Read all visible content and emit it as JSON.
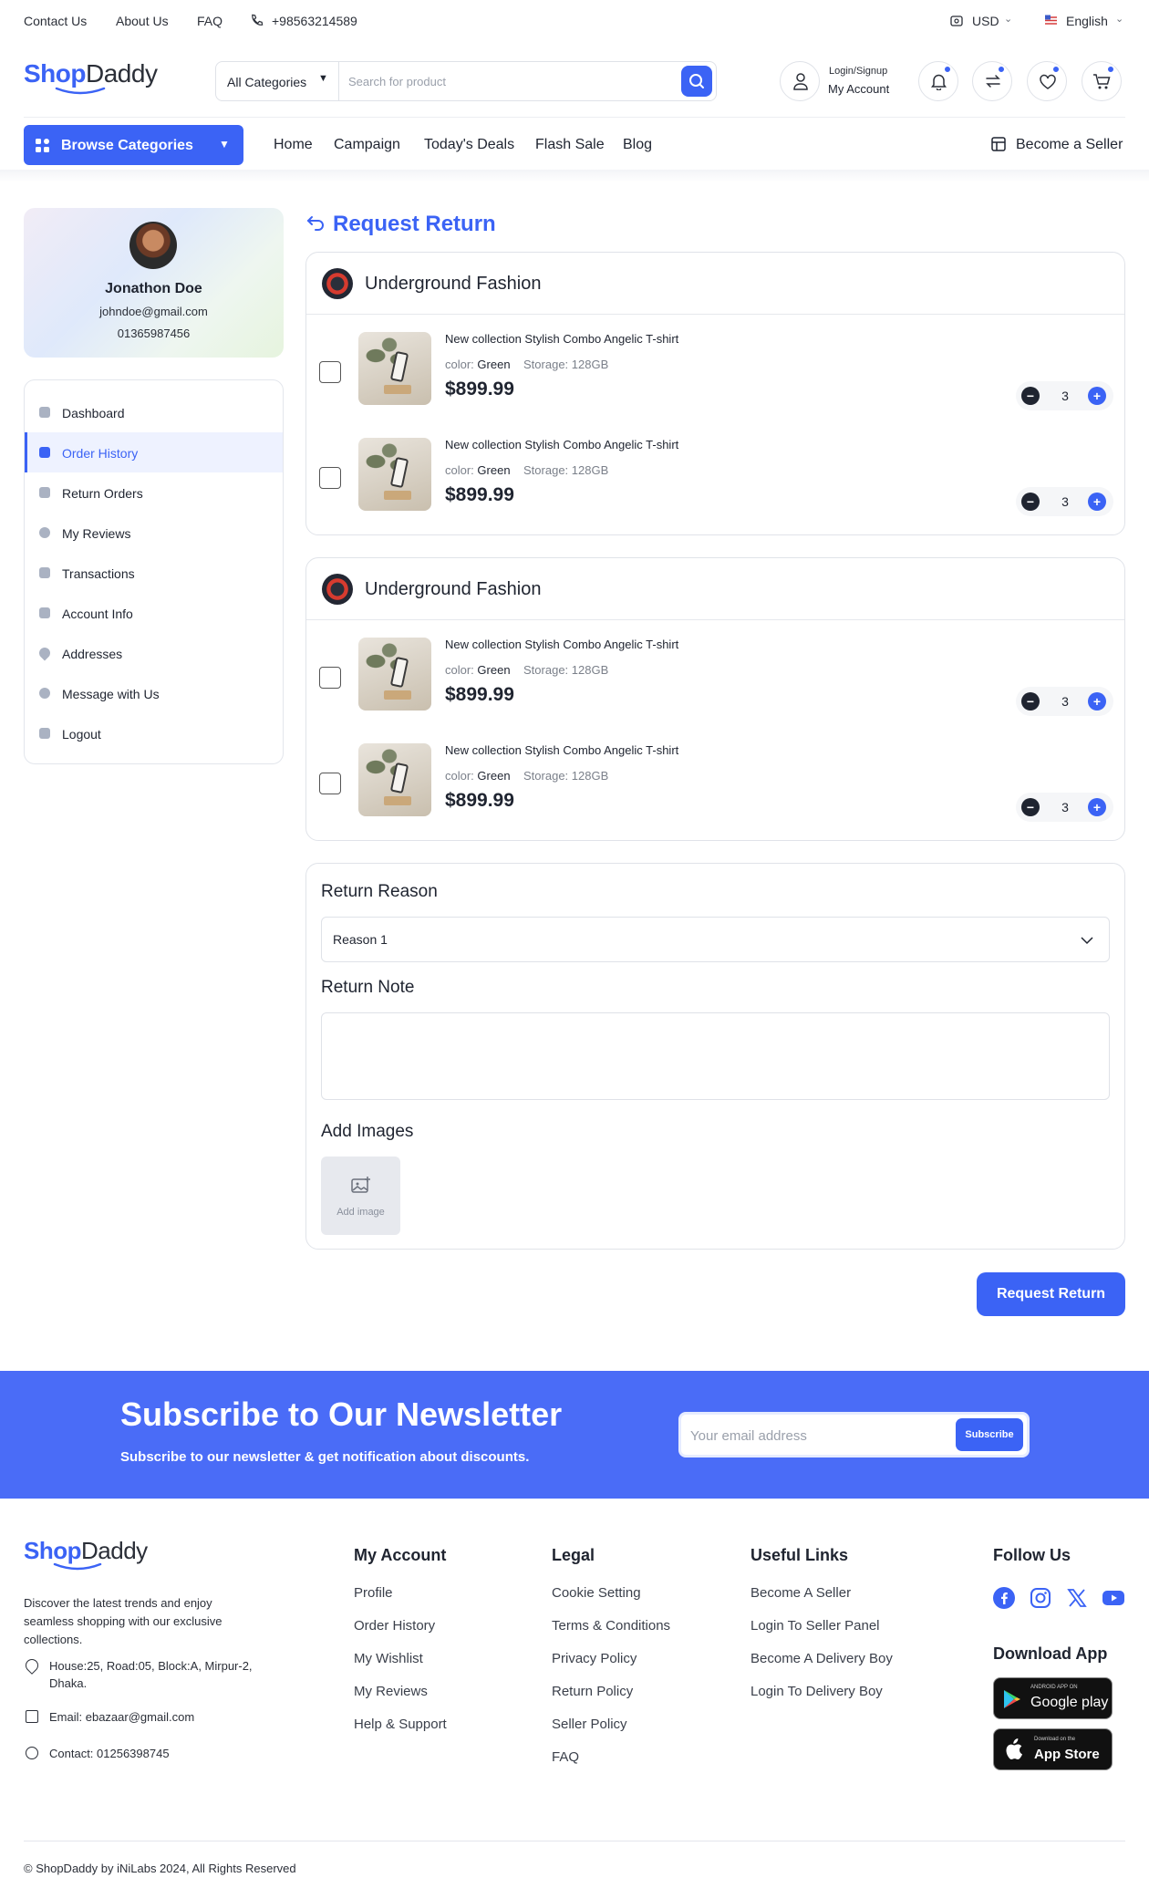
{
  "topbar": {
    "contact": "Contact Us",
    "about": "About Us",
    "faq": "FAQ",
    "phone": "+98563214589",
    "currency": "USD",
    "language": "English"
  },
  "header": {
    "logo_a": "Shop",
    "logo_b": "Daddy",
    "category_select": "All Categories",
    "search_placeholder": "Search for product",
    "login_label": "Login/Signup",
    "account_label": "My Account"
  },
  "nav": {
    "browse": "Browse Categories",
    "links": [
      "Home",
      "Campaign",
      "Today's Deals",
      "Flash Sale",
      "Blog"
    ],
    "seller": "Become a Seller"
  },
  "profile": {
    "name": "Jonathon Doe",
    "email": "johndoe@gmail.com",
    "phone": "01365987456"
  },
  "sidebar": {
    "items": [
      {
        "label": "Dashboard"
      },
      {
        "label": "Order History"
      },
      {
        "label": "Return Orders"
      },
      {
        "label": "My Reviews"
      },
      {
        "label": "Transactions"
      },
      {
        "label": "Account Info"
      },
      {
        "label": "Addresses"
      },
      {
        "label": "Message with Us"
      },
      {
        "label": "Logout"
      }
    ],
    "active": "Order History"
  },
  "main": {
    "title": "Request Return",
    "shops": [
      {
        "name": "Underground Fashion",
        "items": [
          {
            "name": "New collection Stylish Combo Angelic T-shirt",
            "color_label": "color:",
            "color": "Green",
            "storage_label": "Storage:",
            "storage": "128GB",
            "price": "$899.99",
            "qty": "3"
          },
          {
            "name": "New collection Stylish Combo Angelic T-shirt",
            "color_label": "color:",
            "color": "Green",
            "storage_label": "Storage:",
            "storage": "128GB",
            "price": "$899.99",
            "qty": "3"
          }
        ]
      },
      {
        "name": "Underground Fashion",
        "items": [
          {
            "name": "New collection Stylish Combo Angelic T-shirt",
            "color_label": "color:",
            "color": "Green",
            "storage_label": "Storage:",
            "storage": "128GB",
            "price": "$899.99",
            "qty": "3"
          },
          {
            "name": "New collection Stylish Combo Angelic T-shirt",
            "color_label": "color:",
            "color": "Green",
            "storage_label": "Storage:",
            "storage": "128GB",
            "price": "$899.99",
            "qty": "3"
          }
        ]
      }
    ],
    "form": {
      "reason_label": "Return Reason",
      "reason_value": "Reason 1",
      "note_label": "Return Note",
      "images_label": "Add Images",
      "add_image": "Add image"
    },
    "submit": "Request Return"
  },
  "newsletter": {
    "title": "Subscribe to Our Newsletter",
    "subtitle": "Subscribe to our newsletter & get notification about discounts.",
    "placeholder": "Your email address",
    "button": "Subscribe"
  },
  "footer": {
    "description": "Discover the latest trends and enjoy seamless shopping with our exclusive collections.",
    "address": "House:25, Road:05, Block:A, Mirpur-2, Dhaka.",
    "email": "Email: ebazaar@gmail.com",
    "contact": "Contact: 01256398745",
    "my_account": {
      "title": "My Account",
      "links": [
        "Profile",
        "Order History",
        "My Wishlist",
        "My Reviews",
        "Help & Support"
      ]
    },
    "legal": {
      "title": "Legal",
      "links": [
        "Cookie Setting",
        "Terms & Conditions",
        "Privacy Policy",
        "Return Policy",
        "Seller Policy",
        "FAQ"
      ]
    },
    "useful": {
      "title": "Useful Links",
      "links": [
        "Become A Seller",
        "Login To Seller Panel",
        "Become A Delivery Boy",
        "Login To Delivery Boy"
      ]
    },
    "follow": "Follow Us",
    "download": "Download App",
    "google_small": "ANDROID APP ON",
    "google": "Google play",
    "apple_small": "Download on the",
    "apple": "App Store",
    "copyright": "© ShopDaddy by iNiLabs 2024, All Rights Reserved"
  },
  "colors": {
    "accent": "#3b63f5",
    "newsletter_bg": "#4a6cf7"
  }
}
